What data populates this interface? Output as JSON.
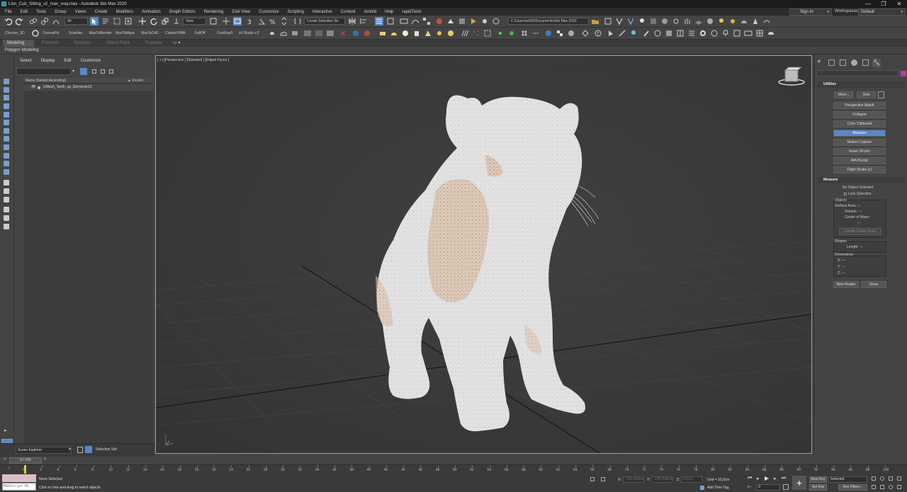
{
  "window": {
    "title": "Lion_Cub_Sitting_v2_max_vray.max - Autodesk 3ds Max 2020",
    "minimize": "—",
    "maximize": "❐",
    "close": "✕"
  },
  "menu": {
    "items": [
      "File",
      "Edit",
      "Tools",
      "Group",
      "Views",
      "Create",
      "Modifiers",
      "Animation",
      "Graph Editors",
      "Rendering",
      "Civil View",
      "Customize",
      "Scripting",
      "Interactive",
      "Content",
      "Arnold",
      "Help",
      "rapidTools"
    ]
  },
  "account": {
    "signin": "Sign In",
    "workspaces_label": "Workspaces:",
    "workspace": "Default"
  },
  "toolbar": {
    "filter": "All",
    "ref_coord": "View",
    "selection_set": "Create Selection Se",
    "project_path": "C:\\Users\\art3D\\Documents\\3ds Max 2020"
  },
  "toolbar2": {
    "labels": [
      "Checker_3D",
      "CoronaPix",
      "Scanline",
      "MaxToBlender",
      "MaxToMaya",
      "MaxToC4D",
      "ClassicVRMt",
      "FallOff",
      "ContExpS",
      "zd Studio v.2"
    ]
  },
  "ribbon": {
    "tabs": [
      "Modeling",
      "Freeform",
      "Selection",
      "Object Paint",
      "Populate"
    ],
    "sub": "Polygon Modeling"
  },
  "scene_explorer": {
    "menu": [
      "Select",
      "Display",
      "Edit",
      "Customize"
    ],
    "col_name": "Name (Sorted Ascending)",
    "col_frozen": "▲ Frozen",
    "items": [
      "UMesh_Teeth_up_Elements13"
    ],
    "footer_name": "Scene Explorer",
    "selection_set_label": "Selection Set:"
  },
  "viewport": {
    "label": "[ + ] [Perspective ] [Standard ] [Edged Faces ]"
  },
  "command_panel": {
    "utilities_title": "Utilities",
    "more": "More...",
    "sets": "Sets",
    "utilities": [
      "Perspective Match",
      "Collapse",
      "Color Clipboard",
      "Measure",
      "Motion Capture",
      "Reset XForm",
      "MAXScript",
      "Flight Studio (c)"
    ],
    "active_utility": "Measure",
    "measure_title": "Measure",
    "no_object": "No Object Selected",
    "lock_selection": "Lock Selection",
    "objects_label": "Objects",
    "surface_area": "Surface Area: ---",
    "volume": "Volume: ---",
    "center_of_mass": "Center of Mass:",
    "com_value": "---",
    "create_center_point": "Create Center Point",
    "shapes_label": "Shapes",
    "length": "Length: ---",
    "dimensions_label": "Dimensions",
    "dim_x": "X:   ---",
    "dim_y": "Y:   ---",
    "dim_z": "Z:   ---",
    "new_floater": "New Floater",
    "close": "Close"
  },
  "timeline": {
    "range": "0 / 100",
    "ticks": [
      "0",
      "2",
      "4",
      "6",
      "8",
      "10",
      "12",
      "14",
      "16",
      "18",
      "20",
      "22",
      "24",
      "26",
      "28",
      "30",
      "32",
      "34",
      "36",
      "38",
      "40",
      "42",
      "44",
      "46",
      "48",
      "50",
      "52",
      "54",
      "56",
      "58",
      "60",
      "62",
      "64",
      "66",
      "68",
      "70",
      "72",
      "74",
      "76",
      "78",
      "80",
      "82",
      "84",
      "86",
      "88",
      "90",
      "92",
      "94",
      "96",
      "98",
      "100"
    ]
  },
  "status": {
    "none_selected": "None Selected",
    "prompt": "Click or click-and-drag to select objects",
    "maxscript": "MAXScript Mi",
    "x_label": "X:",
    "x_val": "-125,818cm",
    "y_label": "Y:",
    "y_val": "-126,258cm",
    "z_label": "Z:",
    "z_val": "0,0cm",
    "grid": "Grid = 10,0cm",
    "add_time_tag": "Add Time Tag",
    "auto_key": "Auto Key",
    "set_key": "Set Key",
    "key_mode": "Selected",
    "key_filters": "Key Filters...",
    "frame": "0"
  },
  "colors": {
    "accent": "#5b87c4",
    "viewport_border": "#c8a23a",
    "fur": "#e2e2e2",
    "fur_tint": "#c49a78"
  }
}
